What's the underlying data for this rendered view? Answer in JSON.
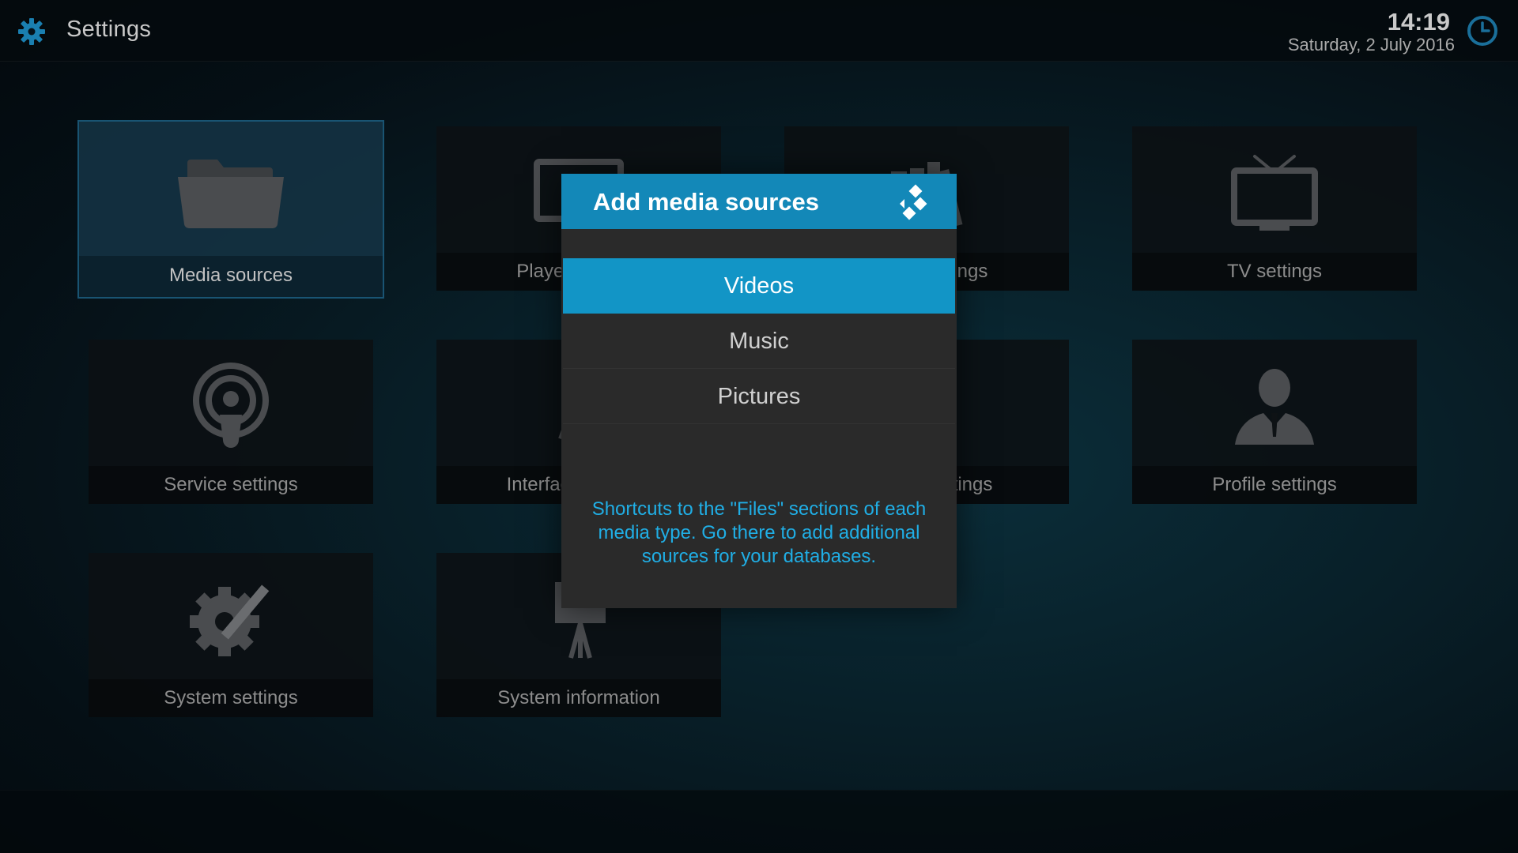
{
  "header": {
    "title": "Settings",
    "time": "14:19",
    "date": "Saturday, 2 July 2016"
  },
  "tiles": [
    {
      "label": "Media sources",
      "icon": "folder-icon"
    },
    {
      "label": "Player settings",
      "icon": "tv-play-icon"
    },
    {
      "label": "Media settings",
      "icon": "books-icon"
    },
    {
      "label": "TV settings",
      "icon": "tv-icon"
    },
    {
      "label": "Service settings",
      "icon": "podcast-icon"
    },
    {
      "label": "Interface settings",
      "icon": "pencil-ruler-icon"
    },
    {
      "label": "Games settings",
      "icon": "tools-icon"
    },
    {
      "label": "Profile settings",
      "icon": "person-icon"
    },
    {
      "label": "System settings",
      "icon": "gear-tools-icon"
    },
    {
      "label": "System information",
      "icon": "presentation-icon"
    }
  ],
  "dialog": {
    "title": "Add media sources",
    "items": [
      "Videos",
      "Music",
      "Pictures"
    ],
    "selected": "Videos",
    "help": "Shortcuts to the \"Files\" sections of each media type. Go there to add additional sources for your databases."
  },
  "colors": {
    "accent": "#1295c6",
    "header": "#1388b8",
    "help_text": "#20aee5",
    "dialog_bg": "#2a2a2a"
  }
}
